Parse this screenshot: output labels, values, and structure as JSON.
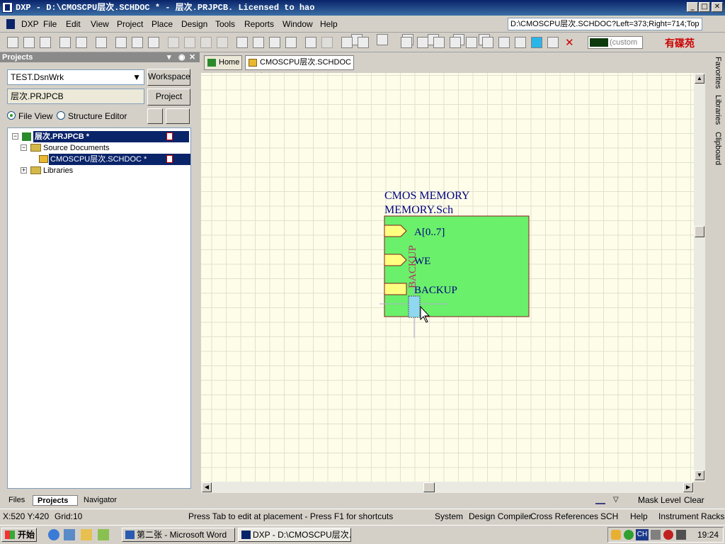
{
  "window": {
    "title": "DXP - D:\\CMOSCPU层次.SCHDOC * - 层次.PRJPCB. Licensed to hao",
    "minimize": "_",
    "maximize": "□",
    "close": "✕"
  },
  "menu": [
    "DXP",
    "File",
    "Edit",
    "View",
    "Project",
    "Place",
    "Design",
    "Tools",
    "Reports",
    "Window",
    "Help"
  ],
  "toolbar": {
    "path_value": "D:\\CMOSCPU层次.SCHDOC?Left=373;Right=714;Top",
    "color_label": "(custom",
    "color_swatch": "#0d3a0d"
  },
  "projects_panel": {
    "header": "Projects",
    "workspace_value": "TEST.DsnWrk",
    "workspace_button": "Workspace",
    "project_value": "层次.PRJPCB",
    "project_button": "Project",
    "file_view_label": "File View",
    "structure_editor_label": "Structure Editor",
    "tree": {
      "project": "层次.PRJPCB *",
      "source_documents": "Source Documents",
      "document": "CMOSCPU层次.SCHDOC *",
      "libraries": "Libraries"
    },
    "bottom_tabs": [
      "Files",
      "Projects",
      "Navigator"
    ]
  },
  "document": {
    "tabs": [
      "Home",
      "CMOSCPU层次.SCHDOC *"
    ],
    "sheet_symbol": {
      "designator": "CMOS MEMORY",
      "filename": "MEMORY.Sch",
      "fill": "#6af06a",
      "entries": [
        "A[0..7]",
        "WE",
        "BACKUP"
      ],
      "floating_entry": "BACKUP"
    }
  },
  "right_panels": [
    "Favorites",
    "Libraries",
    "Clipboard"
  ],
  "status": {
    "coords": "X:520 Y:420",
    "grid": "Grid:10",
    "hint": "Press Tab to edit at placement - Press F1 for shortcuts",
    "mask_level": "Mask Level",
    "clear": "Clear",
    "panels": [
      "System",
      "Design Compiler",
      "Cross References",
      "SCH",
      "Help",
      "Instrument Racks"
    ]
  },
  "taskbar": {
    "start": "开始",
    "tasks": [
      "第二张 - Microsoft Word",
      "DXP - D:\\CMOSCPU层次...."
    ],
    "ime": "CH",
    "clock": "19:24"
  },
  "logo": "有碟苑"
}
